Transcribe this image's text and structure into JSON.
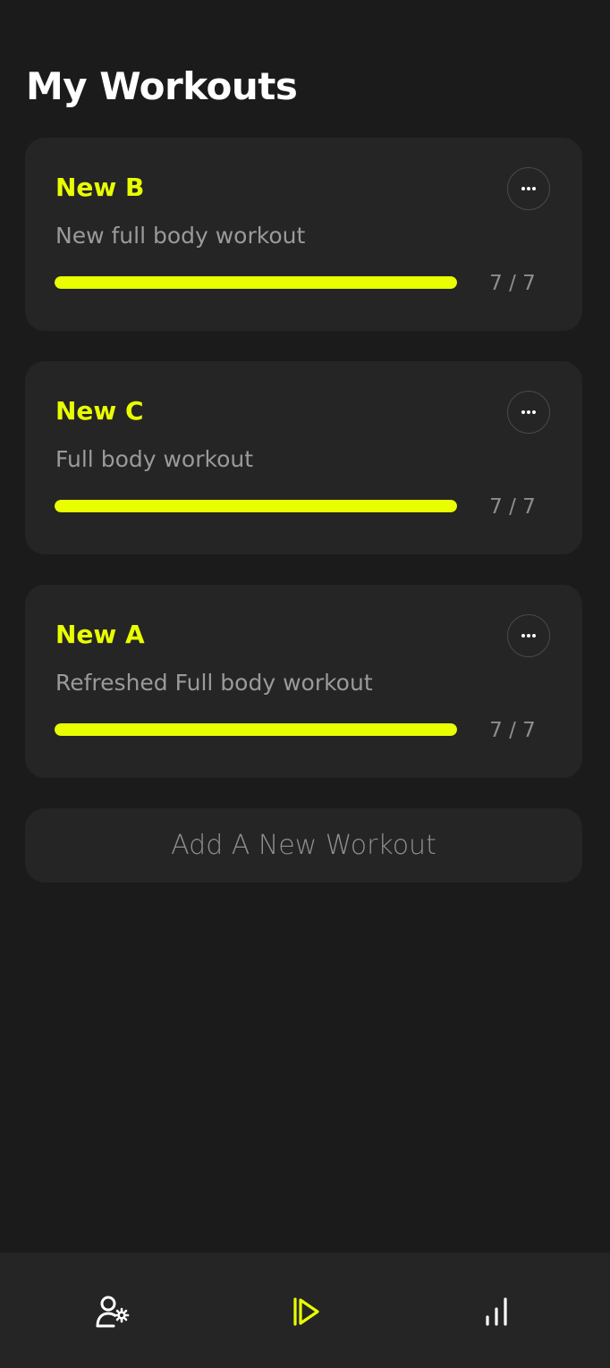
{
  "header": {
    "title": "My Workouts"
  },
  "workouts": [
    {
      "name": "New B",
      "description": "New full body workout",
      "progress_text": "7 / 7",
      "completed": 7,
      "total": 7
    },
    {
      "name": "New C",
      "description": "Full body workout",
      "progress_text": "7 / 7",
      "completed": 7,
      "total": 7
    },
    {
      "name": "New A",
      "description": "Refreshed Full body workout",
      "progress_text": "7 / 7",
      "completed": 7,
      "total": 7
    }
  ],
  "add_button": {
    "label": "Add A New Workout"
  },
  "nav": {
    "items": [
      {
        "icon": "user-settings-icon",
        "active": false
      },
      {
        "icon": "play-workout-icon",
        "active": true
      },
      {
        "icon": "stats-bar-chart-icon",
        "active": false
      }
    ]
  },
  "colors": {
    "background": "#1b1b1b",
    "card": "#252525",
    "accent": "#e9ff00",
    "text_primary": "#ffffff",
    "text_secondary": "#9a9a9a"
  }
}
